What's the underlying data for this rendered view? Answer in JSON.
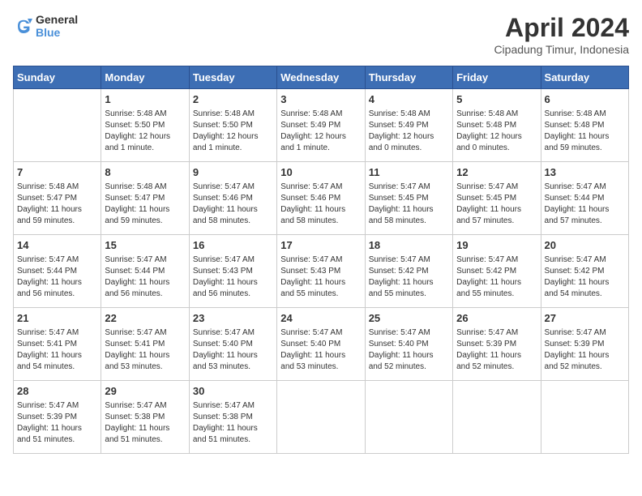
{
  "header": {
    "logo_line1": "General",
    "logo_line2": "Blue",
    "month_title": "April 2024",
    "location": "Cipadung Timur, Indonesia"
  },
  "weekdays": [
    "Sunday",
    "Monday",
    "Tuesday",
    "Wednesday",
    "Thursday",
    "Friday",
    "Saturday"
  ],
  "weeks": [
    [
      {
        "day": "",
        "info": ""
      },
      {
        "day": "1",
        "info": "Sunrise: 5:48 AM\nSunset: 5:50 PM\nDaylight: 12 hours\nand 1 minute."
      },
      {
        "day": "2",
        "info": "Sunrise: 5:48 AM\nSunset: 5:50 PM\nDaylight: 12 hours\nand 1 minute."
      },
      {
        "day": "3",
        "info": "Sunrise: 5:48 AM\nSunset: 5:49 PM\nDaylight: 12 hours\nand 1 minute."
      },
      {
        "day": "4",
        "info": "Sunrise: 5:48 AM\nSunset: 5:49 PM\nDaylight: 12 hours\nand 0 minutes."
      },
      {
        "day": "5",
        "info": "Sunrise: 5:48 AM\nSunset: 5:48 PM\nDaylight: 12 hours\nand 0 minutes."
      },
      {
        "day": "6",
        "info": "Sunrise: 5:48 AM\nSunset: 5:48 PM\nDaylight: 11 hours\nand 59 minutes."
      }
    ],
    [
      {
        "day": "7",
        "info": "Sunrise: 5:48 AM\nSunset: 5:47 PM\nDaylight: 11 hours\nand 59 minutes."
      },
      {
        "day": "8",
        "info": "Sunrise: 5:48 AM\nSunset: 5:47 PM\nDaylight: 11 hours\nand 59 minutes."
      },
      {
        "day": "9",
        "info": "Sunrise: 5:47 AM\nSunset: 5:46 PM\nDaylight: 11 hours\nand 58 minutes."
      },
      {
        "day": "10",
        "info": "Sunrise: 5:47 AM\nSunset: 5:46 PM\nDaylight: 11 hours\nand 58 minutes."
      },
      {
        "day": "11",
        "info": "Sunrise: 5:47 AM\nSunset: 5:45 PM\nDaylight: 11 hours\nand 58 minutes."
      },
      {
        "day": "12",
        "info": "Sunrise: 5:47 AM\nSunset: 5:45 PM\nDaylight: 11 hours\nand 57 minutes."
      },
      {
        "day": "13",
        "info": "Sunrise: 5:47 AM\nSunset: 5:44 PM\nDaylight: 11 hours\nand 57 minutes."
      }
    ],
    [
      {
        "day": "14",
        "info": "Sunrise: 5:47 AM\nSunset: 5:44 PM\nDaylight: 11 hours\nand 56 minutes."
      },
      {
        "day": "15",
        "info": "Sunrise: 5:47 AM\nSunset: 5:44 PM\nDaylight: 11 hours\nand 56 minutes."
      },
      {
        "day": "16",
        "info": "Sunrise: 5:47 AM\nSunset: 5:43 PM\nDaylight: 11 hours\nand 56 minutes."
      },
      {
        "day": "17",
        "info": "Sunrise: 5:47 AM\nSunset: 5:43 PM\nDaylight: 11 hours\nand 55 minutes."
      },
      {
        "day": "18",
        "info": "Sunrise: 5:47 AM\nSunset: 5:42 PM\nDaylight: 11 hours\nand 55 minutes."
      },
      {
        "day": "19",
        "info": "Sunrise: 5:47 AM\nSunset: 5:42 PM\nDaylight: 11 hours\nand 55 minutes."
      },
      {
        "day": "20",
        "info": "Sunrise: 5:47 AM\nSunset: 5:42 PM\nDaylight: 11 hours\nand 54 minutes."
      }
    ],
    [
      {
        "day": "21",
        "info": "Sunrise: 5:47 AM\nSunset: 5:41 PM\nDaylight: 11 hours\nand 54 minutes."
      },
      {
        "day": "22",
        "info": "Sunrise: 5:47 AM\nSunset: 5:41 PM\nDaylight: 11 hours\nand 53 minutes."
      },
      {
        "day": "23",
        "info": "Sunrise: 5:47 AM\nSunset: 5:40 PM\nDaylight: 11 hours\nand 53 minutes."
      },
      {
        "day": "24",
        "info": "Sunrise: 5:47 AM\nSunset: 5:40 PM\nDaylight: 11 hours\nand 53 minutes."
      },
      {
        "day": "25",
        "info": "Sunrise: 5:47 AM\nSunset: 5:40 PM\nDaylight: 11 hours\nand 52 minutes."
      },
      {
        "day": "26",
        "info": "Sunrise: 5:47 AM\nSunset: 5:39 PM\nDaylight: 11 hours\nand 52 minutes."
      },
      {
        "day": "27",
        "info": "Sunrise: 5:47 AM\nSunset: 5:39 PM\nDaylight: 11 hours\nand 52 minutes."
      }
    ],
    [
      {
        "day": "28",
        "info": "Sunrise: 5:47 AM\nSunset: 5:39 PM\nDaylight: 11 hours\nand 51 minutes."
      },
      {
        "day": "29",
        "info": "Sunrise: 5:47 AM\nSunset: 5:38 PM\nDaylight: 11 hours\nand 51 minutes."
      },
      {
        "day": "30",
        "info": "Sunrise: 5:47 AM\nSunset: 5:38 PM\nDaylight: 11 hours\nand 51 minutes."
      },
      {
        "day": "",
        "info": ""
      },
      {
        "day": "",
        "info": ""
      },
      {
        "day": "",
        "info": ""
      },
      {
        "day": "",
        "info": ""
      }
    ]
  ]
}
